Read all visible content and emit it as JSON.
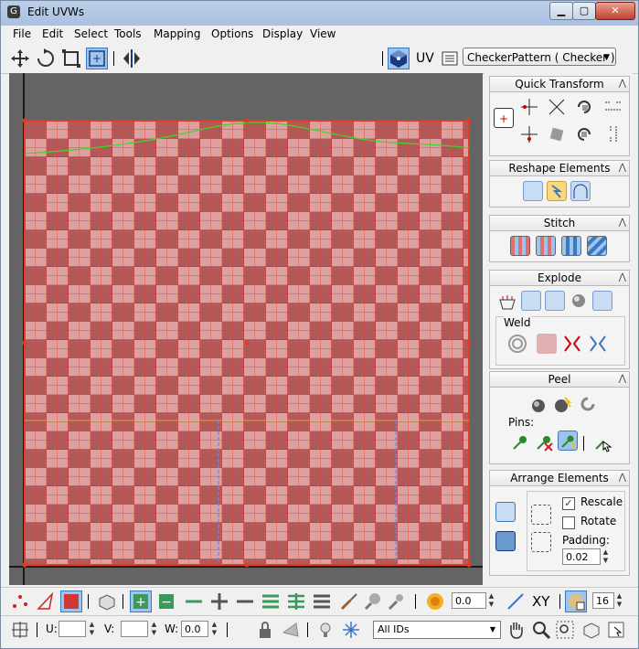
{
  "window": {
    "title": "Edit UVWs"
  },
  "menu": [
    "File",
    "Edit",
    "Select",
    "Tools",
    "Mapping",
    "Options",
    "Display",
    "View"
  ],
  "toolbar": {
    "uv_label": "UV",
    "texture_dropdown": "CheckerPattern  ( Checker )"
  },
  "panel": {
    "quick_transform": "Quick Transform",
    "reshape_elements": "Reshape Elements",
    "stitch": "Stitch",
    "explode": "Explode",
    "weld": "Weld",
    "peel": "Peel",
    "pins": "Pins:",
    "arrange_elements": "Arrange Elements",
    "rescale": {
      "label": "Rescale",
      "checked": true
    },
    "rotate": {
      "label": "Rotate",
      "checked": false
    },
    "padding": {
      "label": "Padding:",
      "value": "0.02"
    }
  },
  "bottom": {
    "soft_value": "0.0",
    "xy_label": "XY",
    "grid_value": "16",
    "u_label": "U:",
    "u_value": "",
    "v_label": "V:",
    "v_value": "",
    "w_label": "W:",
    "w_value": "0.0",
    "ids_dropdown": "All IDs"
  },
  "colors": {
    "accent": "#3a78c0",
    "checker_dark": "#b25a5a",
    "checker_light": "#dca0a0",
    "uv_edges": "#e03c28",
    "seam": "#5a8cff"
  }
}
